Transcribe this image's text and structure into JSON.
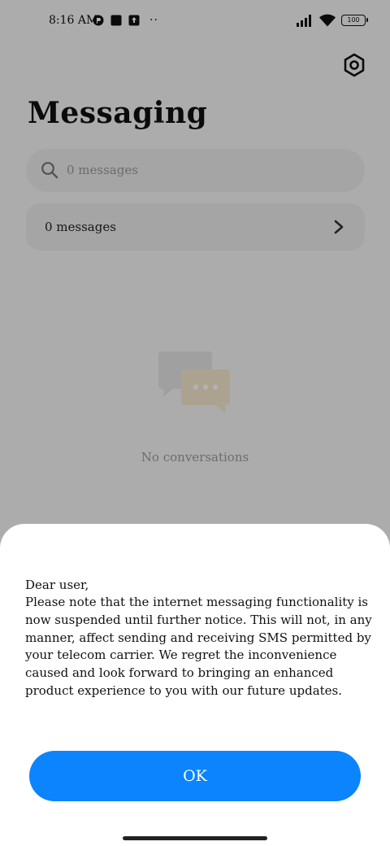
{
  "status_bar": {
    "time": "8:16 AM",
    "battery": "100",
    "more": "··",
    "icons": [
      "notification-app-icon",
      "square-icon",
      "upload-icon",
      "signal-icon",
      "wifi-icon",
      "battery-icon"
    ]
  },
  "header": {
    "title": "Messaging",
    "settings_icon": "settings-hex-icon"
  },
  "search": {
    "placeholder": "0 messages",
    "icon": "search-icon"
  },
  "folder_row": {
    "label": "0 messages",
    "icon": "chevron-right-icon"
  },
  "empty_state": {
    "text": "No conversations",
    "icon": "chat-bubbles-icon"
  },
  "dialog": {
    "greeting": "Dear user,",
    "body": "Please note that the internet messaging functionality is now suspended until further notice. This will not, in any manner, affect sending and receiving SMS permitted by your telecom carrier. We regret the inconvenience caused and look forward to bringing an enhanced product experience to you with our future updates.",
    "ok_label": "OK"
  },
  "colors": {
    "accent": "#0b84fe",
    "overlay": "rgba(0,0,0,0.30)",
    "sheet_bg": "#ffffff"
  }
}
